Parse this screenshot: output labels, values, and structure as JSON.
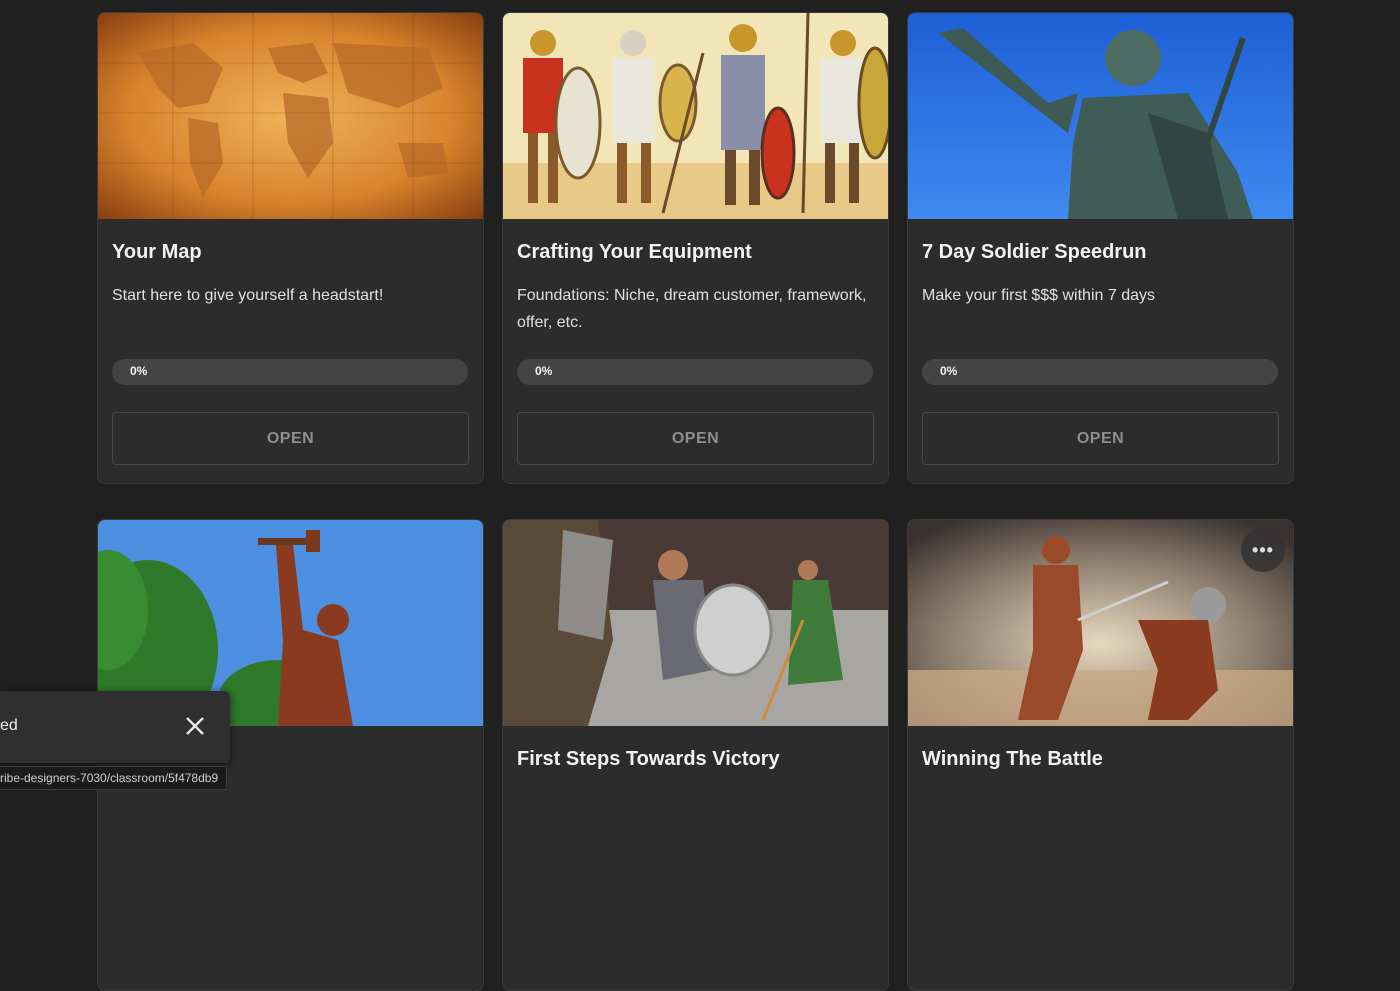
{
  "courses": [
    {
      "title": "Your Map",
      "description": "Start here to give yourself a headstart!",
      "progress_label": "0%",
      "progress": 0,
      "button_label": "OPEN",
      "image": "antique-world-map"
    },
    {
      "title": "Crafting Your Equipment",
      "description": "Foundations: Niche, dream customer, framework, offer, etc.",
      "progress_label": "0%",
      "progress": 0,
      "button_label": "OPEN",
      "image": "roman-soldiers-illustration"
    },
    {
      "title": "7 Day Soldier Speedrun",
      "description": "Make your first $$$ within 7 days",
      "progress_label": "0%",
      "progress": 0,
      "button_label": "OPEN",
      "image": "emperor-statue-blue-sky"
    },
    {
      "title": "",
      "description": "",
      "image": "self-made-man-statue"
    },
    {
      "title": "First Steps Towards Victory",
      "description": "",
      "image": "gladiator-arena-fight"
    },
    {
      "title": "Winning The Battle",
      "description": "",
      "image": "gladiators-dust-battle",
      "menu_label": "•••"
    }
  ],
  "snackbar": {
    "text": "ed",
    "close_icon": "close-icon"
  },
  "status_bar": {
    "url": "ribe-designers-7030/classroom/5f478db9"
  },
  "colors": {
    "background": "#202020",
    "card": "#2c2c2c",
    "progress_track": "#444444",
    "button_text": "#8e8e8e"
  }
}
